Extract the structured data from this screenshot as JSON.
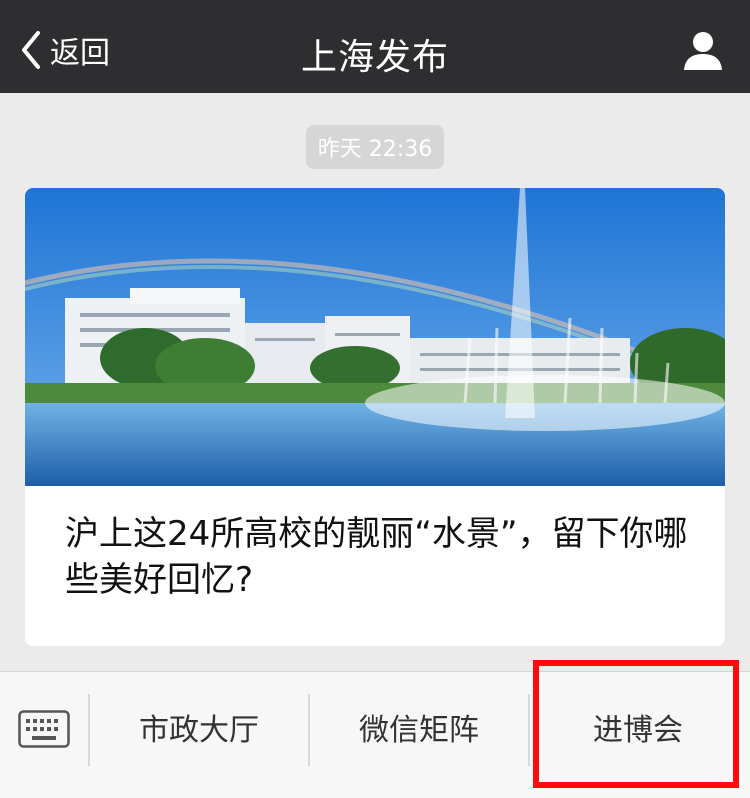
{
  "navbar": {
    "back_label": "返回",
    "title": "上海发布",
    "icons": {
      "back": "chevron-left-icon",
      "profile": "person-icon"
    }
  },
  "message": {
    "timestamp": "昨天 22:36"
  },
  "article": {
    "title": "沪上这24所高校的靓丽“水景”，留下你哪些美好回忆?"
  },
  "menu": {
    "keyboard_icon": "keyboard-icon",
    "items": [
      {
        "label": "市政大厅"
      },
      {
        "label": "微信矩阵"
      },
      {
        "label": "进博会"
      }
    ],
    "highlight_color": "#ff0b0b"
  }
}
